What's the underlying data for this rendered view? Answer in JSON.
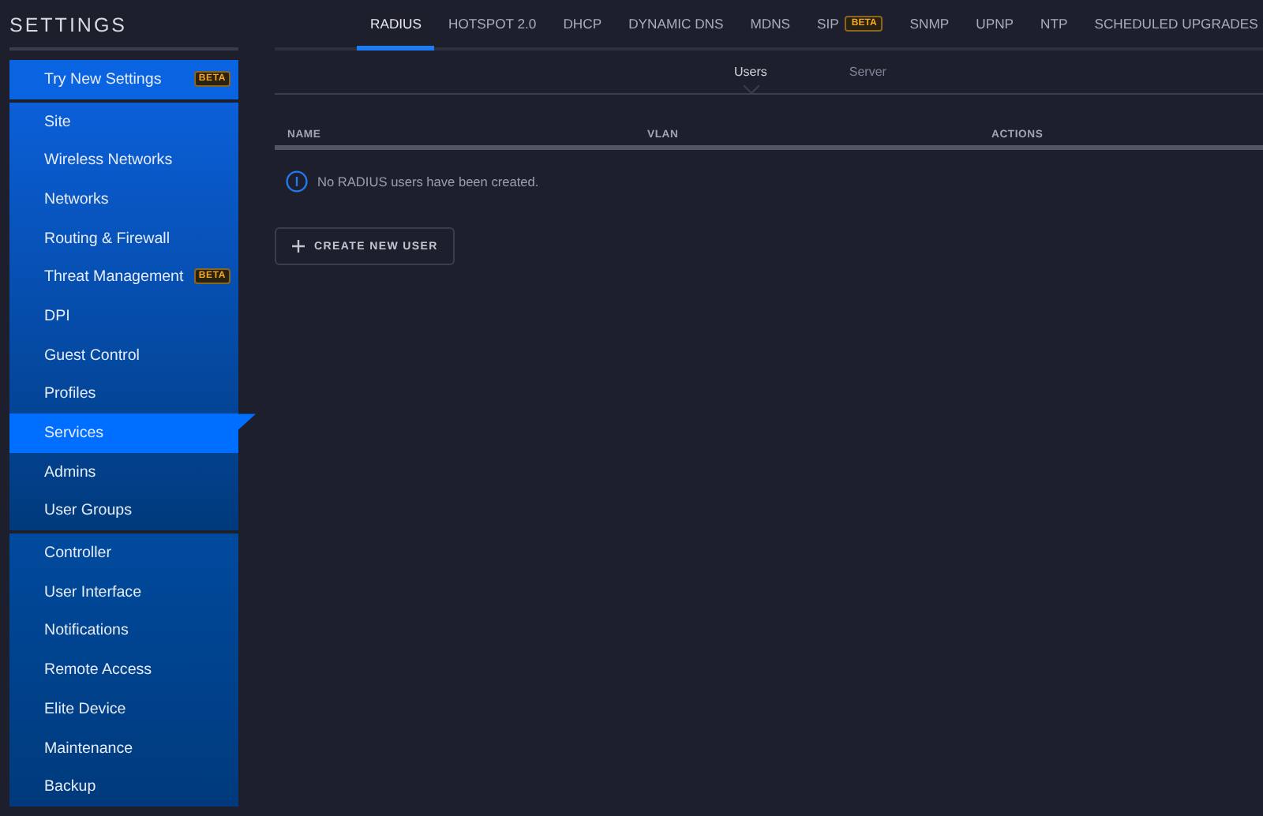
{
  "sidebar": {
    "title": "SETTINGS",
    "groups": [
      {
        "items": [
          {
            "label": "Try New Settings",
            "badge": "BETA",
            "selected": false
          }
        ]
      },
      {
        "items": [
          {
            "label": "Site",
            "selected": false
          },
          {
            "label": "Wireless Networks",
            "selected": false
          },
          {
            "label": "Networks",
            "selected": false
          },
          {
            "label": "Routing & Firewall",
            "selected": false
          },
          {
            "label": "Threat Management",
            "badge": "BETA",
            "selected": false
          },
          {
            "label": "DPI",
            "selected": false
          },
          {
            "label": "Guest Control",
            "selected": false
          },
          {
            "label": "Profiles",
            "selected": false
          },
          {
            "label": "Services",
            "selected": true
          },
          {
            "label": "Admins",
            "selected": false
          },
          {
            "label": "User Groups",
            "selected": false
          }
        ]
      },
      {
        "items": [
          {
            "label": "Controller",
            "selected": false
          },
          {
            "label": "User Interface",
            "selected": false
          },
          {
            "label": "Notifications",
            "selected": false
          },
          {
            "label": "Remote Access",
            "selected": false
          },
          {
            "label": "Elite Device",
            "selected": false
          },
          {
            "label": "Maintenance",
            "selected": false
          },
          {
            "label": "Backup",
            "selected": false
          }
        ]
      }
    ]
  },
  "tabs": [
    {
      "label": "RADIUS",
      "selected": true
    },
    {
      "label": "HOTSPOT 2.0",
      "selected": false
    },
    {
      "label": "DHCP",
      "selected": false
    },
    {
      "label": "DYNAMIC DNS",
      "selected": false
    },
    {
      "label": "MDNS",
      "selected": false
    },
    {
      "label": "SIP",
      "badge": "BETA",
      "selected": false
    },
    {
      "label": "SNMP",
      "selected": false
    },
    {
      "label": "UPNP",
      "selected": false
    },
    {
      "label": "NTP",
      "selected": false
    },
    {
      "label": "SCHEDULED UPGRADES",
      "selected": false
    }
  ],
  "subtabs": [
    {
      "label": "Users",
      "selected": true
    },
    {
      "label": "Server",
      "selected": false
    }
  ],
  "table": {
    "columns": [
      "NAME",
      "VLAN",
      "ACTIONS"
    ],
    "empty_message": "No RADIUS users have been created."
  },
  "create_button": {
    "label": "CREATE NEW USER"
  }
}
